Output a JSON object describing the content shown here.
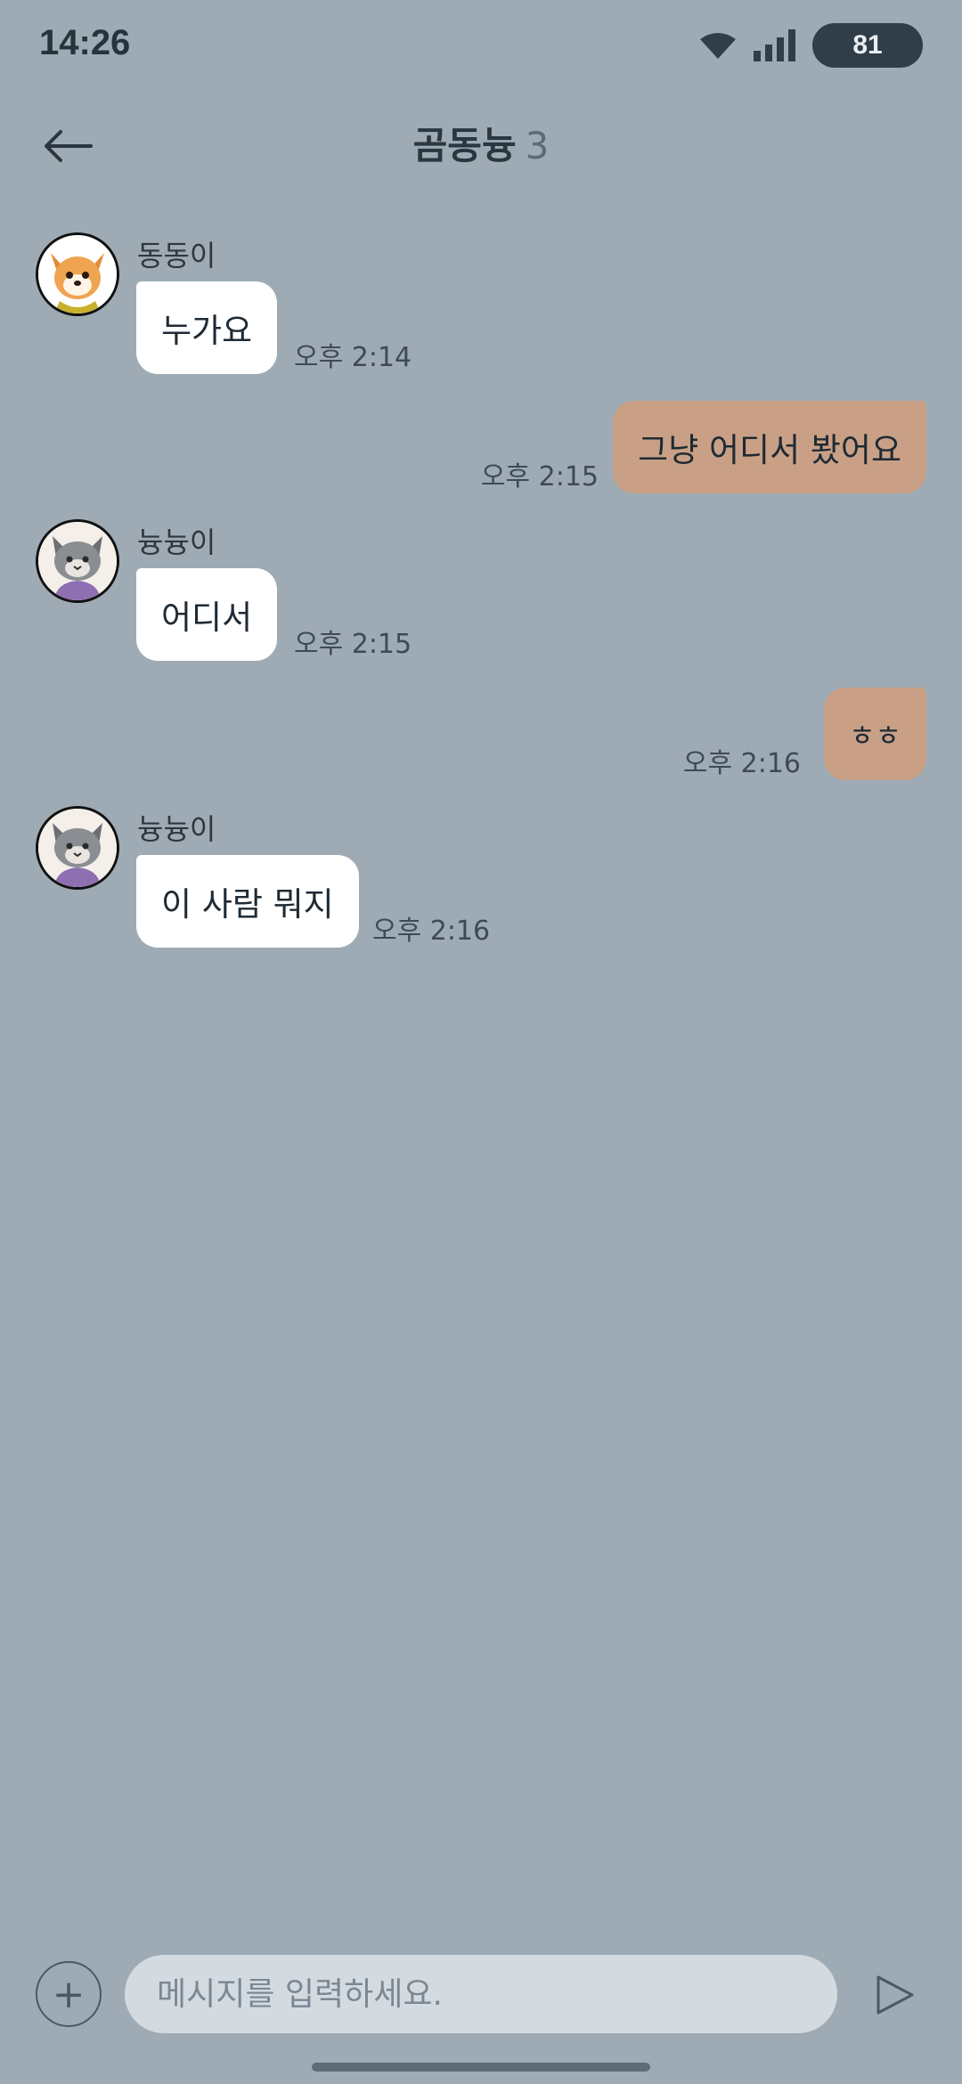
{
  "status_bar": {
    "time": "14:26",
    "battery": "81"
  },
  "header": {
    "title": "곰동늉",
    "member_count": "3"
  },
  "messages": [
    {
      "type": "in",
      "sender": "동동이",
      "avatar": "dog-avatar",
      "text": "누가요",
      "time": "오후 2:14"
    },
    {
      "type": "out",
      "text": "그냥 어디서 봤어요",
      "time": "오후 2:15"
    },
    {
      "type": "in",
      "sender": "늉늉이",
      "avatar": "cat-avatar",
      "text": "어디서",
      "time": "오후 2:15"
    },
    {
      "type": "out",
      "text": "ㅎㅎ",
      "time": "오후 2:16"
    },
    {
      "type": "in",
      "sender": "늉늉이",
      "avatar": "cat-avatar",
      "text": "이 사람 뭐지",
      "time": "오후 2:16"
    }
  ],
  "input": {
    "placeholder": "메시지를 입력하세요.",
    "add_label": "+"
  },
  "icons": {
    "back": "back-arrow-icon",
    "send": "send-icon",
    "add": "plus-icon",
    "wifi": "wifi-icon",
    "signal": "signal-icon"
  },
  "colors": {
    "background": "#9eabb5",
    "incoming_bubble": "#ffffff",
    "outgoing_bubble": "#c9a086"
  }
}
